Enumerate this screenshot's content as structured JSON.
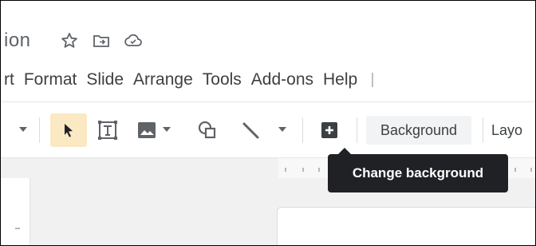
{
  "title": {
    "text": "ion",
    "icons": [
      "star-icon",
      "move-to-folder-icon",
      "cloud-saved-icon"
    ]
  },
  "menu": {
    "items": [
      "rt",
      "Format",
      "Slide",
      "Arrange",
      "Tools",
      "Add-ons",
      "Help"
    ]
  },
  "toolbar": {
    "background_label": "Background",
    "layout_label": "Layo",
    "icons": [
      "select-arrow-icon",
      "text-box-icon",
      "image-icon",
      "shape-icon",
      "line-icon",
      "new-comment-icon"
    ]
  },
  "tooltip": {
    "text": "Change background"
  },
  "colors": {
    "active_tool_bg": "#fbe9c4",
    "tooltip_bg": "#202124",
    "icon_gray": "#5f6368"
  }
}
